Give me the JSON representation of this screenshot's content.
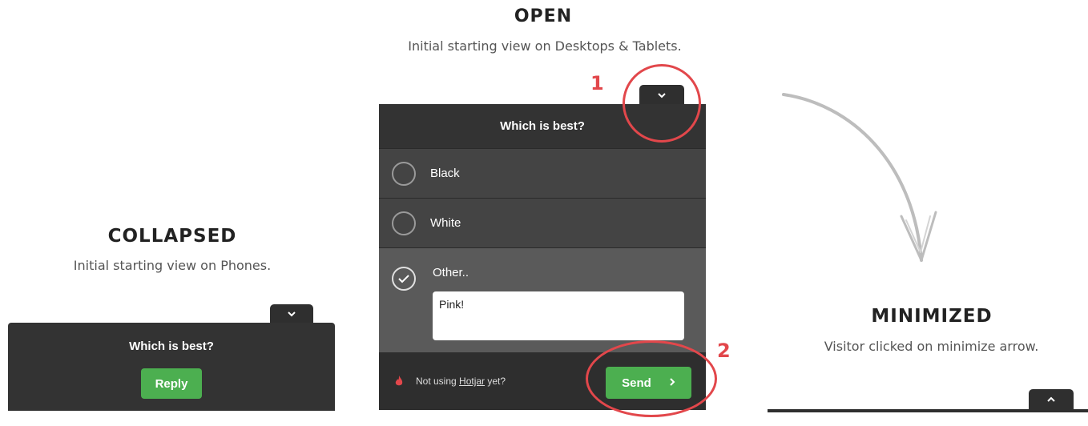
{
  "collapsed": {
    "heading": "COLLAPSED",
    "subheading": "Initial starting view on Phones.",
    "question": "Which is best?",
    "reply_label": "Reply",
    "toggle_icon": "chevron-down-icon"
  },
  "open": {
    "heading": "OPEN",
    "subheading": "Initial starting view on Desktops & Tablets.",
    "question": "Which is best?",
    "options": [
      {
        "label": "Black",
        "checked": false
      },
      {
        "label": "White",
        "checked": false
      },
      {
        "label": "Other..",
        "checked": true
      }
    ],
    "other_value": "Pink!",
    "footer_prefix": "Not using ",
    "footer_link": "Hotjar",
    "footer_suffix": " yet?",
    "send_label": "Send",
    "send_icon": "chevron-right-icon",
    "toggle_icon": "chevron-down-icon",
    "callout_1": "1",
    "callout_2": "2"
  },
  "minimized": {
    "heading": "MINIMIZED",
    "subheading": "Visitor clicked on minimize arrow.",
    "toggle_icon": "chevron-up-icon"
  },
  "colors": {
    "panel": "#333333",
    "accent_green": "#4caf50",
    "callout_red": "#e2474b"
  }
}
